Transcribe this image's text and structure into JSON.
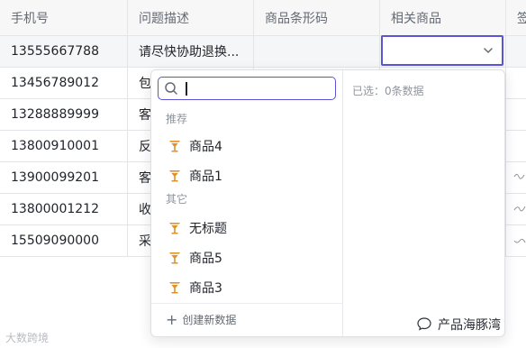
{
  "table": {
    "headers": [
      "手机号",
      "问题描述",
      "商品条形码",
      "相关商品",
      "签"
    ],
    "rows": [
      {
        "phone": "13555667788",
        "desc": "请尽快协助退换..."
      },
      {
        "phone": "13456789012",
        "desc": "包"
      },
      {
        "phone": "13288889999",
        "desc": "客"
      },
      {
        "phone": "13800910001",
        "desc": "反"
      },
      {
        "phone": "13900099201",
        "desc": "客"
      },
      {
        "phone": "13800001212",
        "desc": "收"
      },
      {
        "phone": "15509090000",
        "desc": "采"
      }
    ]
  },
  "dropdown": {
    "search_placeholder": "",
    "recommended_label": "推荐",
    "recommended": [
      "商品4",
      "商品1"
    ],
    "other_label": "其它",
    "other": [
      "无标题",
      "商品5",
      "商品3"
    ],
    "create_label": "创建新数据",
    "selected_text": "已选：0条数据"
  },
  "watermark": {
    "left": "大数跨境",
    "right": "产品海豚湾"
  },
  "colors": {
    "accent": "#5b55d6",
    "item_icon": "#e0912a"
  }
}
